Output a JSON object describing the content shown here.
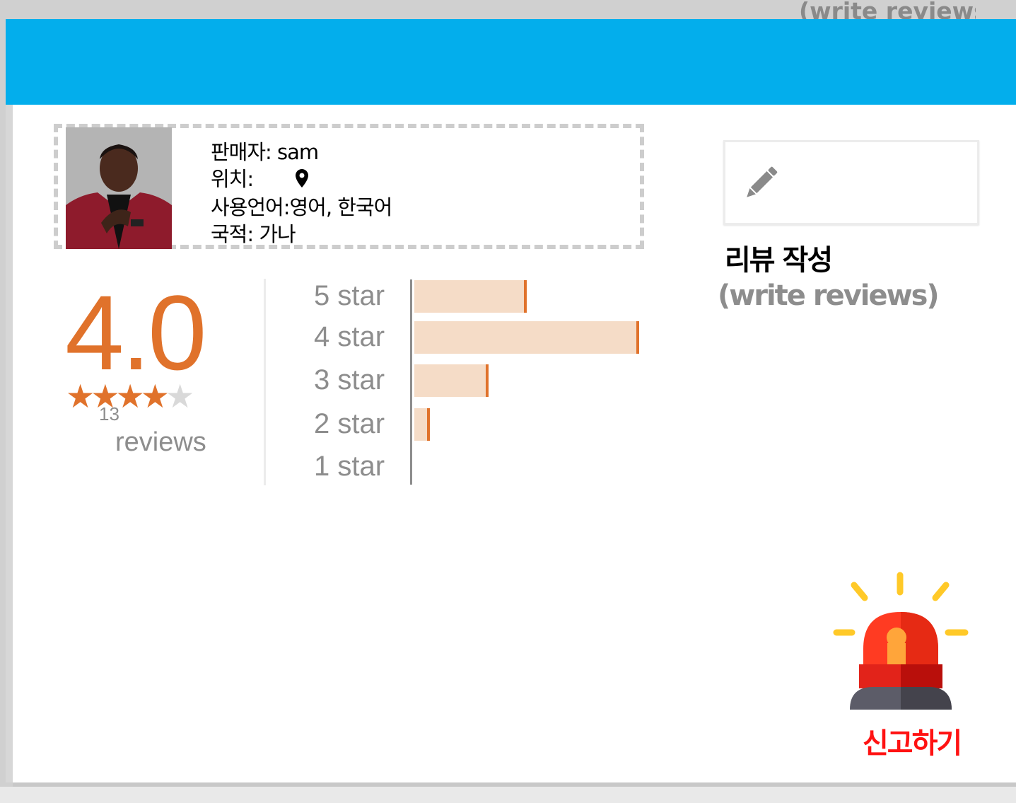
{
  "header": {
    "ghost_text": "(write reviews)"
  },
  "seller": {
    "name_label": "판매자: sam",
    "location_label": "위치:",
    "location_icon": "map-pin-icon",
    "languages_label": "사용언어:영어, 한국어",
    "nationality_label": "국적: 가나"
  },
  "rating": {
    "score": "4.0",
    "stars_filled": 4,
    "stars_total": 5,
    "review_count": "13",
    "reviews_label": "reviews",
    "accent_color": "#e0722b"
  },
  "distribution": [
    {
      "label": "5 star",
      "fraction": 0.5
    },
    {
      "label": "4 star",
      "fraction": 1.0
    },
    {
      "label": "3 star",
      "fraction": 0.33
    },
    {
      "label": "2 star",
      "fraction": 0.05
    },
    {
      "label": "1 star",
      "fraction": 0.0
    }
  ],
  "write_review": {
    "icon": "pencil-icon",
    "title": "리뷰 작성",
    "subtitle": "(write reviews)"
  },
  "report": {
    "icon": "siren-icon",
    "label": "신고하기",
    "label_color": "#ff1212"
  },
  "colors": {
    "header": "#03aeec"
  }
}
